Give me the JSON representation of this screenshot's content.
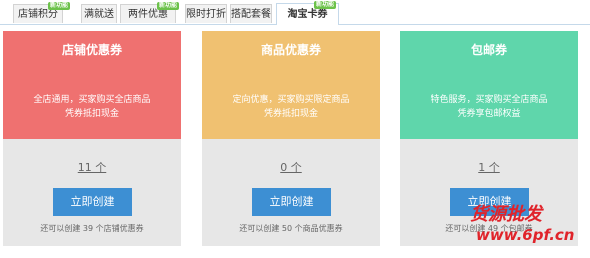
{
  "tabs": [
    {
      "label": "店铺积分",
      "badge": "新功能"
    },
    {
      "label": "满就送",
      "badge": ""
    },
    {
      "label": "两件优惠",
      "badge": "新功能"
    },
    {
      "label": "限时打折",
      "badge": ""
    },
    {
      "label": "搭配套餐",
      "badge": ""
    },
    {
      "label": "淘宝卡券",
      "badge": "新功能"
    }
  ],
  "cards": [
    {
      "title": "店铺优惠券",
      "desc1": "全店通用，买家购买全店商品",
      "desc2": "凭券抵扣现金",
      "count": "11 个",
      "button": "立即创建",
      "hint": "还可以创建 39 个店铺优惠券",
      "color": "#ef7170"
    },
    {
      "title": "商品优惠券",
      "desc1": "定向优惠，买家购买限定商品",
      "desc2": "凭券抵扣现金",
      "count": "0 个",
      "button": "立即创建",
      "hint": "还可以创建 50 个商品优惠券",
      "color": "#f0c171"
    },
    {
      "title": "包邮券",
      "desc1": "特色服务，买家购买全店商品",
      "desc2": "凭券享包邮权益",
      "count": "1 个",
      "button": "立即创建",
      "hint": "还可以创建 49 个包邮券",
      "color": "#5fd6ab"
    }
  ],
  "watermark": {
    "line1": "货源批发",
    "line2": "www.6pf.cn"
  }
}
